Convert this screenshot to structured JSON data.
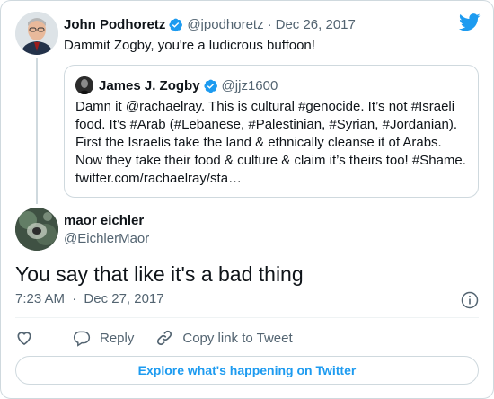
{
  "colors": {
    "brand_blue": "#1d9bf0",
    "text_primary": "#0f1419",
    "text_muted": "#536471",
    "border": "#cfd9de"
  },
  "parent_tweet": {
    "author_name": "John Podhoretz",
    "handle": "@jpodhoretz",
    "separator": "·",
    "date": "Dec 26, 2017",
    "text": "Dammit Zogby, you're a ludicrous buffoon!",
    "verified_icon": "verified-badge-icon"
  },
  "quoted_tweet": {
    "author_name": "James J. Zogby",
    "handle": "@jjz1600",
    "lines": [
      "Damn it @rachaelray. This is cultural #genocide. It’s not #Israeli",
      "food. It’s #Arab (#Lebanese, #Palestinian, #Syrian, #Jordanian).",
      "First the Israelis take the land & ethnically cleanse it of Arabs.",
      "Now they take their food & culture & claim it’s theirs too! #Shame.",
      "twitter.com/rachaelray/sta…"
    ]
  },
  "reply_tweet": {
    "author_name": "maor eichler",
    "handle": "@EichlerMaor",
    "text": "You say that like it's a bad thing",
    "time": "7:23 AM",
    "separator": "·",
    "date": "Dec 27, 2017"
  },
  "actions": {
    "like_icon": "heart-icon",
    "reply_label": "Reply",
    "copy_link_label": "Copy link to Tweet"
  },
  "footer": {
    "explore_label": "Explore what's happening on Twitter"
  }
}
